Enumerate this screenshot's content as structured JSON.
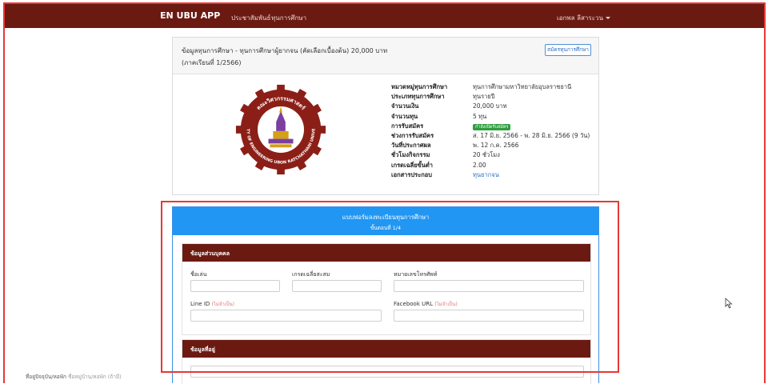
{
  "navbar": {
    "brand": "EN UBU APP",
    "links": [
      "ประชาสัมพันธ์",
      "ทุนการศึกษา"
    ],
    "user": "เอกพล ลีสาระวน"
  },
  "scholarship": {
    "title": "ข้อมูลทุนการศึกษา - ทุนการศึกษาผู้ยากจน (คัดเลือกเบื้องต้น) 20,000 บาท (ภาคเรียนที่ 1/2566)",
    "apply_button": "สมัครทุนการศึกษา",
    "logo_ring_top": "คณะวิศวกรรมศาสตร์",
    "logo_ring_bottom": "FACULTY OF ENGINEERING UBON RATCHATHANI UNIVERSITY",
    "details": [
      {
        "key": "หมวดหมู่ทุนการศึกษา",
        "value": "ทุนการศึกษามหาวิทยาลัยอุบลราชธานี"
      },
      {
        "key": "ประเภททุนการศึกษา",
        "value": "ทุนรายปี"
      },
      {
        "key": "จำนวนเงิน",
        "value": "20,000 บาท"
      },
      {
        "key": "จำนวนทุน",
        "value": "5 ทุน"
      },
      {
        "key": "การรับสมัคร",
        "value": "กำลังเปิดรับสมัคร"
      },
      {
        "key": "ช่วงการรับสมัคร",
        "value": "ส. 17 มิ.ย. 2566 - พ. 28 มิ.ย. 2566 (9 วัน)"
      },
      {
        "key": "วันที่ประกาศผล",
        "value": "พ. 12 ก.ค. 2566"
      },
      {
        "key": "ชั่วโมงกิจกรรม",
        "value": "20 ชั่วโมง"
      },
      {
        "key": "เกรดเฉลี่ยขั้นต่ำ",
        "value": "2.00"
      },
      {
        "key": "เอกสารประกอบ",
        "value": "ทุนยากจน"
      }
    ],
    "badge_color": "#2e9e3f"
  },
  "form": {
    "title": "แบบฟอร์มลงทะเบียนทุนการศึกษา",
    "step": "ขั้นตอนที่ 1/4",
    "personal": {
      "heading": "ข้อมูลส่วนบุคคล",
      "nickname_label": "ชื่อเล่น",
      "gpa_label": "เกรดเฉลี่ยสะสม",
      "phone_label": "หมายเลขโทรศัพท์",
      "line_label": "Line ID",
      "facebook_label": "Facebook URL",
      "optional_tag": "(ไม่จำเป็น)"
    },
    "address": {
      "heading": "ข้อมูลที่อยู่",
      "current_label": "ที่อยู่ปัจจุบัน/หอพัก",
      "current_hint": "ชื่อหมู่บ้าน/หอพัก (ถ้ามี)"
    }
  },
  "colors": {
    "navbar": "#6b1a12",
    "form_header": "#2196f3",
    "section_header": "#6b1a12",
    "highlight": "#e53935"
  },
  "icons": {
    "cursor": "mouse-pointer-icon"
  }
}
